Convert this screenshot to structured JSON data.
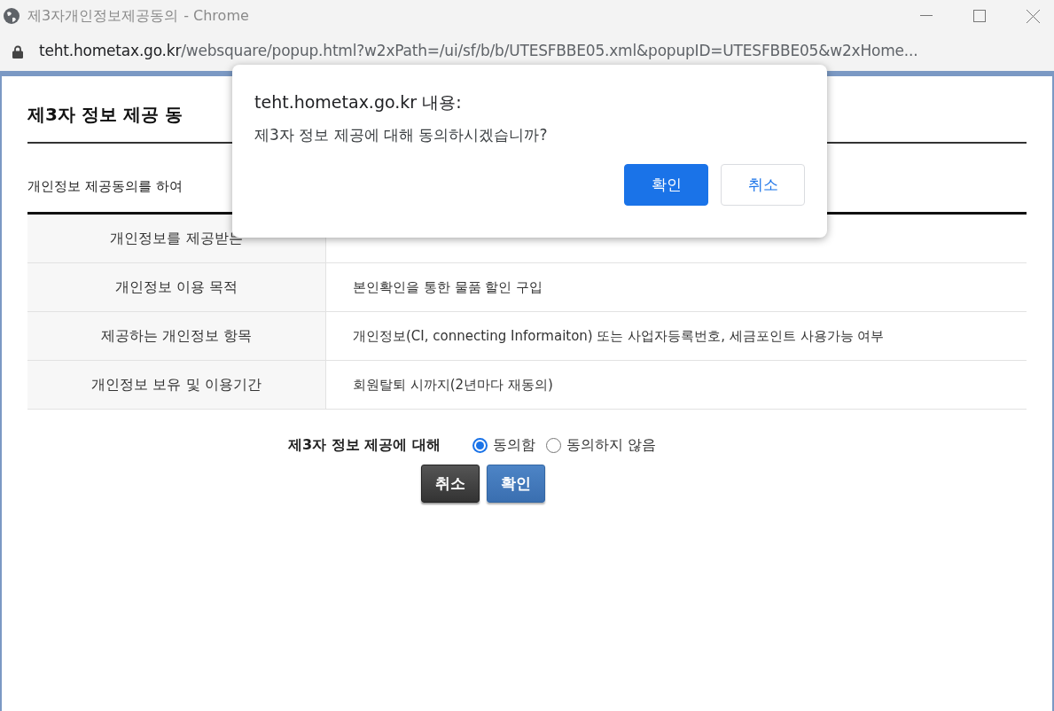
{
  "window": {
    "title": "제3자개인정보제공동의",
    "app": "- Chrome"
  },
  "address_bar": {
    "host": "teht.hometax.go.kr",
    "path": "/websquare/popup.html?w2xPath=/ui/sf/b/b/UTESFBBE05.xml&popupID=UTESFBBE05&w2xHome..."
  },
  "page": {
    "title": "제3자 정보 제공 동",
    "intro": "개인정보 제공동의를 하여",
    "rows": [
      {
        "label": "개인정보를 제공받는"
      },
      {
        "label": "개인정보 이용 목적",
        "value": "본인확인을 통한 물품 할인 구입"
      },
      {
        "label": "제공하는 개인정보 항목",
        "value": "개인정보(CI, connecting Informaiton) 또는 사업자등록번호, 세금포인트 사용가능 여부"
      },
      {
        "label": "개인정보 보유 및 이용기간",
        "value": "회원탈퇴 시까지(2년마다 재동의)"
      }
    ],
    "consent": {
      "label": "제3자 정보 제공에 대해",
      "options": [
        {
          "label": "동의함",
          "selected": true
        },
        {
          "label": "동의하지 않음",
          "selected": false
        }
      ]
    },
    "buttons": [
      {
        "label": "취소",
        "kind": "cancel"
      },
      {
        "label": "확인",
        "kind": "confirm"
      }
    ]
  },
  "dialog": {
    "title": "teht.hometax.go.kr 내용:",
    "message": "제3자 정보 제공에 대해 동의하시겠습니까?",
    "buttons": [
      {
        "label": "확인",
        "kind": "confirm"
      },
      {
        "label": "취소",
        "kind": "cancel"
      }
    ]
  }
}
